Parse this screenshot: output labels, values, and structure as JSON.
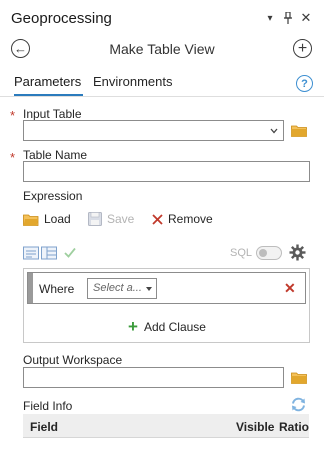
{
  "pane": {
    "title": "Geoprocessing",
    "pin_glyph": "↓",
    "pin_caret": "▾",
    "pin_icon": "pin-icon",
    "close_glyph": "✕"
  },
  "tool": {
    "title": "Make Table View",
    "back_glyph": "←",
    "add_glyph": "+"
  },
  "tabs": [
    {
      "label": "Parameters",
      "active": true
    },
    {
      "label": "Environments",
      "active": false
    }
  ],
  "help_glyph": "?",
  "params": {
    "input_table": {
      "label": "Input Table",
      "required": true,
      "value": ""
    },
    "table_name": {
      "label": "Table Name",
      "required": true,
      "value": ""
    },
    "expression": {
      "label": "Expression",
      "load_label": "Load",
      "save_label": "Save",
      "remove_label": "Remove",
      "sql_label": "SQL",
      "clause": {
        "where_label": "Where",
        "select_placeholder": "Select a...",
        "remove_glyph": "✕"
      },
      "add_clause_label": "Add Clause",
      "add_glyph": "+"
    },
    "output_workspace": {
      "label": "Output Workspace",
      "value": ""
    },
    "field_info": {
      "label": "Field Info",
      "columns": [
        "Field",
        "Visible",
        "Ratio"
      ]
    }
  },
  "required_mark": "*",
  "colors": {
    "accent": "#2b7bbd",
    "required": "#c0392b",
    "add": "#3a9b3a",
    "folder": "#e2a72d"
  }
}
